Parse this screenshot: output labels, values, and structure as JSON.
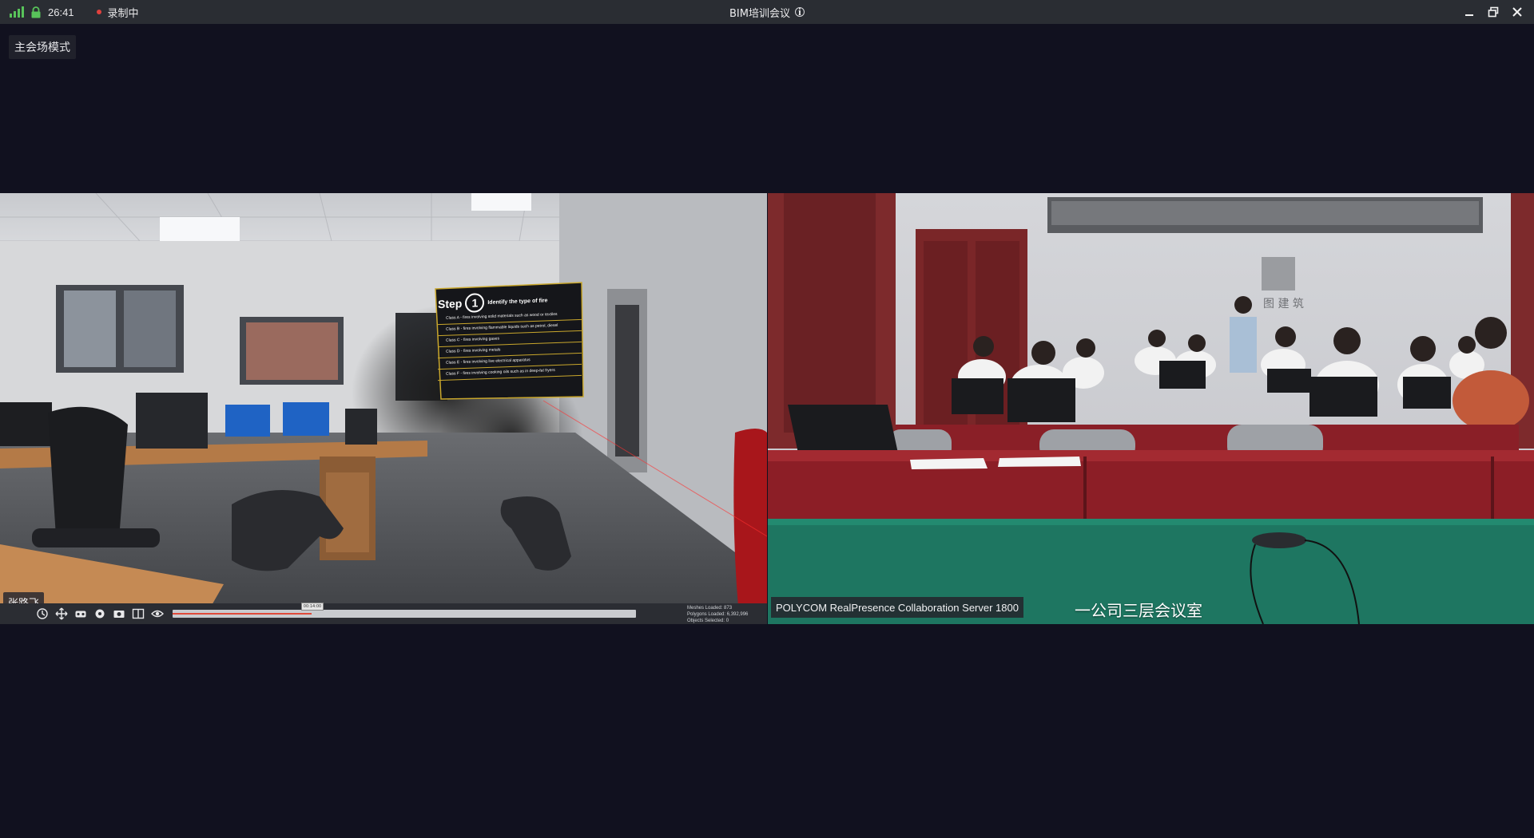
{
  "titlebar": {
    "time": "26:41",
    "recording_label": "录制中",
    "title": "BIM培训会议",
    "icons": [
      "signal-icon",
      "lock-icon",
      "record-icon",
      "info-icon",
      "minimize-icon",
      "restore-icon",
      "close-icon"
    ],
    "colors": {
      "signal": "#58c35a",
      "lock": "#58c35a",
      "record_dot": "#e0413d"
    }
  },
  "mode_badge": {
    "label": "主会场模式"
  },
  "left_tile": {
    "participant_name": "张路飞",
    "vr_panel": {
      "step_word": "Step",
      "step_number": "1",
      "step_title": "Identify the type of fire",
      "classes": [
        "Class A - fires involving solid materials such as wood or textiles",
        "Class B - fires involving flammable liquids such as petrol, diesel",
        "Class C - fires involving gases",
        "Class D - fires involving metals",
        "Class E - fires involving live electrical apparatus",
        "Class F - fires involving cooking oils such as in deep-fat fryers"
      ]
    },
    "toolbar": {
      "icons": [
        "history-icon",
        "move-icon",
        "vr-headset-icon",
        "settings-icon",
        "camera-icon",
        "split-icon",
        "view-icon"
      ],
      "timeline_progress": 0.3,
      "timeline_label": "00:14:00",
      "stats": [
        "Meshes Loaded: 873",
        "Polygons Loaded: 6,392,996",
        "Objects Selected: 0"
      ]
    }
  },
  "right_tile": {
    "server_label": "POLYCOM RealPresence Collaboration Server 1800",
    "room_label": "一公司三层会议室"
  }
}
